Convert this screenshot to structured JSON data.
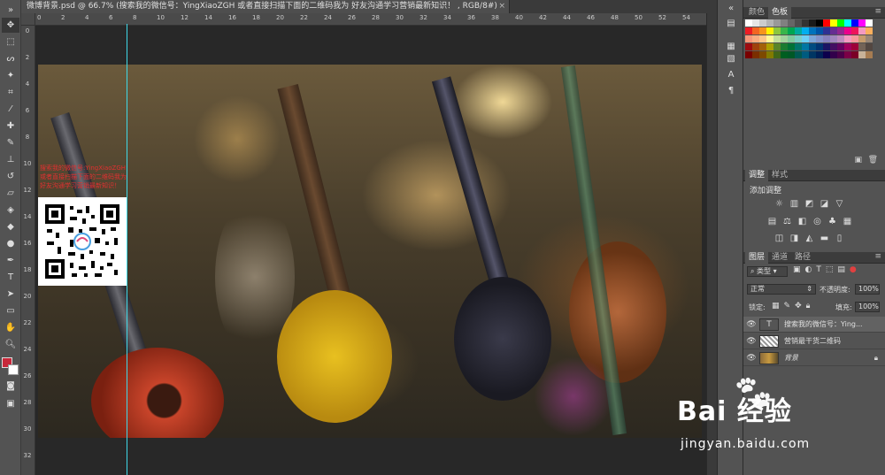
{
  "document": {
    "tab_title": "微博背景.psd @ 66.7% (搜索我的微信号：YingXiaoZGH 或者直接扫描下面的二维码我为 好友沟通学习营销最新知识！ , RGB/8#)",
    "close_glyph": "×"
  },
  "ruler": {
    "top": [
      "0",
      "2",
      "4",
      "6",
      "8",
      "10",
      "12",
      "14",
      "16",
      "18",
      "20",
      "22",
      "24",
      "26",
      "28",
      "30",
      "32",
      "34",
      "36",
      "38",
      "40",
      "42",
      "44",
      "46",
      "48",
      "50",
      "52",
      "54",
      "56"
    ],
    "left": [
      "0",
      "2",
      "4",
      "6",
      "8",
      "10",
      "12",
      "14",
      "16",
      "18",
      "20",
      "22",
      "24",
      "26",
      "28",
      "30",
      "32"
    ]
  },
  "canvas": {
    "qr_caption": "搜索我的微信号:YingXiaoZGH或者直接扫描下面的二维码我为好友沟通学习营销最新知识！"
  },
  "color_panel": {
    "tabs": [
      "颜色",
      "色板"
    ],
    "active_tab": "色板",
    "swatches": [
      "#ffffff",
      "#e6e6e6",
      "#cccccc",
      "#b3b3b3",
      "#999999",
      "#808080",
      "#666666",
      "#4d4d4d",
      "#333333",
      "#1a1a1a",
      "#000000",
      "#ff0000",
      "#ffff00",
      "#00ff00",
      "#00ffff",
      "#0000ff",
      "#ff00ff",
      "#ffffff",
      "#ed1c24",
      "#f26522",
      "#f7941d",
      "#fff200",
      "#8dc63f",
      "#39b54a",
      "#00a651",
      "#00a99d",
      "#00aeef",
      "#0072bc",
      "#0054a6",
      "#2e3192",
      "#662d91",
      "#92278f",
      "#ec008c",
      "#ed145b",
      "#f49ac1",
      "#fbaf5d",
      "#f7977a",
      "#f9ad81",
      "#fdc68a",
      "#fff79a",
      "#c4df9b",
      "#a3d39c",
      "#82ca9d",
      "#7bcdc8",
      "#6dcff6",
      "#7da7d9",
      "#8393ca",
      "#8781bd",
      "#a186be",
      "#bd8cbf",
      "#f49ac2",
      "#f6989d",
      "#c69c6d",
      "#998675",
      "#9e0b0f",
      "#a0410d",
      "#a36209",
      "#aba000",
      "#598527",
      "#1a7b30",
      "#007236",
      "#00746b",
      "#0076a3",
      "#004b80",
      "#003471",
      "#1b1464",
      "#440e62",
      "#630460",
      "#9e005d",
      "#9e0039",
      "#736357",
      "#534741",
      "#790000",
      "#7b2e00",
      "#7d4900",
      "#827b00",
      "#406618",
      "#005e20",
      "#005826",
      "#005952",
      "#005b7f",
      "#003663",
      "#002157",
      "#0d004c",
      "#32004b",
      "#4b0049",
      "#7b0046",
      "#7a0026",
      "#c7b299",
      "#a67c52"
    ]
  },
  "adjustments_panel": {
    "tabs": [
      "调整",
      "样式"
    ],
    "active_tab": "调整",
    "heading": "添加调整",
    "row1": [
      "brightness-icon",
      "levels-icon",
      "curves-icon",
      "exposure-icon",
      "triangle-icon"
    ],
    "row2": [
      "vibrance-icon",
      "balance-icon",
      "bw-icon",
      "photo-filter-icon",
      "mixer-icon",
      "lookup-icon"
    ],
    "row3": [
      "invert-icon",
      "posterize-icon",
      "threshold-icon",
      "gradient-map-icon",
      "selective-icon"
    ]
  },
  "layers_panel": {
    "tabs": [
      "图层",
      "通道",
      "路径"
    ],
    "active_tab": "图层",
    "filter_kind": "类型",
    "blend_mode": "正常",
    "opacity_label": "不透明度:",
    "opacity_value": "100%",
    "lock_label": "锁定:",
    "fill_label": "填充:",
    "fill_value": "100%",
    "layers": [
      {
        "name": "搜索我的微信号：Ying...",
        "type": "text",
        "selected": true
      },
      {
        "name": "营销最干货二维码",
        "type": "image",
        "selected": false
      },
      {
        "name": "背景",
        "type": "background",
        "selected": false
      }
    ]
  },
  "watermark": {
    "logo": "Bai 经验",
    "url": "jingyan.baidu.com"
  }
}
